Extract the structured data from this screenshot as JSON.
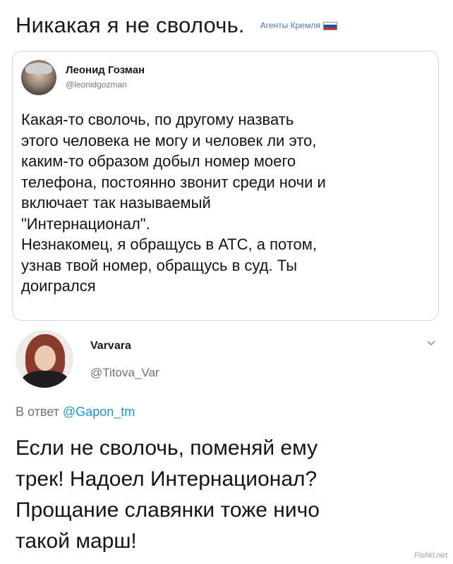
{
  "header": {
    "title": "Никакая я не сволочь.",
    "tag": "Агенты Кремля",
    "flag_icon": "russian-flag-icon",
    "flag_colors": [
      "#ffffff",
      "#1c4fb5",
      "#d52b1e"
    ]
  },
  "quoted_tweet": {
    "author_name": "Леонид Гозман",
    "author_handle": "@leonidgozman",
    "text": "Какая-то сволочь, по другому назвать\nэтого человека не могу и человек ли это,\nкаким-то образом добыл номер моего\nтелефона, постоянно звонит среди ночи и\nвключает так называемый\n\"Интернационал\".\nНезнакомец, я обращусь в АТС, а потом,\nузнав твой номер, обращусь в суд. Ты\nдоигрался"
  },
  "reply_tweet": {
    "author_name": "Varvara",
    "author_handle": "@Titova_Var",
    "reply_prefix": "В ответ",
    "reply_mention": "@Gapon_tm",
    "text": "Если не сволочь, поменяй ему\nтрек! Надоел Интернационал?\nПрощание славянки тоже ничо\nтакой марш!",
    "menu_icon": "chevron-down-icon"
  },
  "watermark": "Fishki.net",
  "colors": {
    "mention": "#1b95e0",
    "secondary_text": "#66757f",
    "border": "#cfd6dc"
  }
}
